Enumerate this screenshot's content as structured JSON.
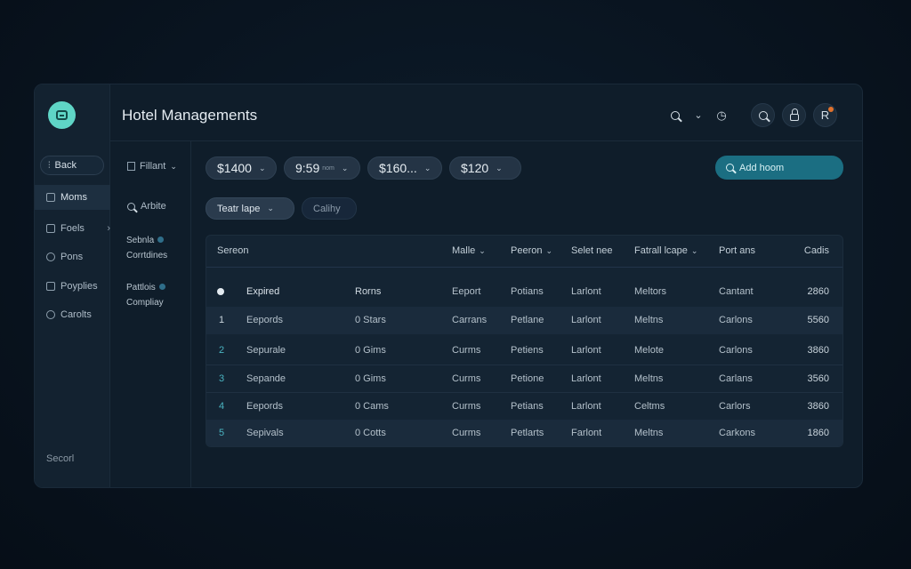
{
  "header": {
    "title": "Hotel Managements",
    "icons": [
      "search-icon",
      "chevron-down-icon",
      "clock-icon",
      "search-icon",
      "lock-icon",
      "user-icon"
    ],
    "avatar_letter": "R"
  },
  "sidebar": {
    "back_label": "Back",
    "items": [
      {
        "label": "Moms",
        "icon": "home-icon",
        "active": true
      },
      {
        "label": "Foels",
        "icon": "grid-icon"
      },
      {
        "label": "Pons",
        "icon": "user-icon"
      },
      {
        "label": "Poyplies",
        "icon": "settings-icon"
      },
      {
        "label": "Carolts",
        "icon": "circle-icon"
      }
    ],
    "footer": "Secorl"
  },
  "subpanel": {
    "filter_label": "Fillant",
    "articles_label": "Arbite",
    "groups": [
      {
        "title": "Sebnla",
        "subtitle": "Corrtdines"
      },
      {
        "title": "Pattlois",
        "subtitle": "Compliay"
      }
    ]
  },
  "toolbar": {
    "pills": [
      "$1400",
      "9:59",
      "$160...",
      "$120"
    ],
    "pill_hint": "nom",
    "add_button": "Add hoom",
    "chip_active": "Teatr lape",
    "chip_ghost": "Calihy"
  },
  "table": {
    "columns": [
      "Sereon",
      "Malle",
      "Peeron",
      "Selet nee",
      "Fatrall lcape",
      "Port ans",
      "Cadis"
    ],
    "sortable": [
      false,
      true,
      true,
      false,
      true,
      false,
      false
    ],
    "rows": [
      {
        "num": "",
        "name": "Expired",
        "room": "Rorns",
        "c1": "Eeport",
        "c2": "Potians",
        "c3": "Larlont",
        "c4": "Meltors",
        "c5": "Cantant",
        "amount": "2860"
      },
      {
        "num": "1",
        "name": "Eepords",
        "room": "0 Stars",
        "c1": "Carrans",
        "c2": "Petlane",
        "c3": "Larlont",
        "c4": "Meltns",
        "c5": "Carlons",
        "amount": "5560"
      },
      {
        "num": "2",
        "name": "Sepurale",
        "room": "0 Gims",
        "c1": "Curms",
        "c2": "Petiens",
        "c3": "Larlont",
        "c4": "Melote",
        "c5": "Carlons",
        "amount": "3860"
      },
      {
        "num": "3",
        "name": "Sepande",
        "room": "0 Gims",
        "c1": "Curms",
        "c2": "Petione",
        "c3": "Larlont",
        "c4": "Meltns",
        "c5": "Carlans",
        "amount": "3560"
      },
      {
        "num": "4",
        "name": "Eepords",
        "room": "0 Cams",
        "c1": "Curms",
        "c2": "Petians",
        "c3": "Larlont",
        "c4": "Celtms",
        "c5": "Carlors",
        "amount": "3860"
      },
      {
        "num": "5",
        "name": "Sepivals",
        "room": "0 Cotts",
        "c1": "Curms",
        "c2": "Petlarts",
        "c3": "Farlont",
        "c4": "Meltns",
        "c5": "Carkons",
        "amount": "1860"
      }
    ]
  }
}
